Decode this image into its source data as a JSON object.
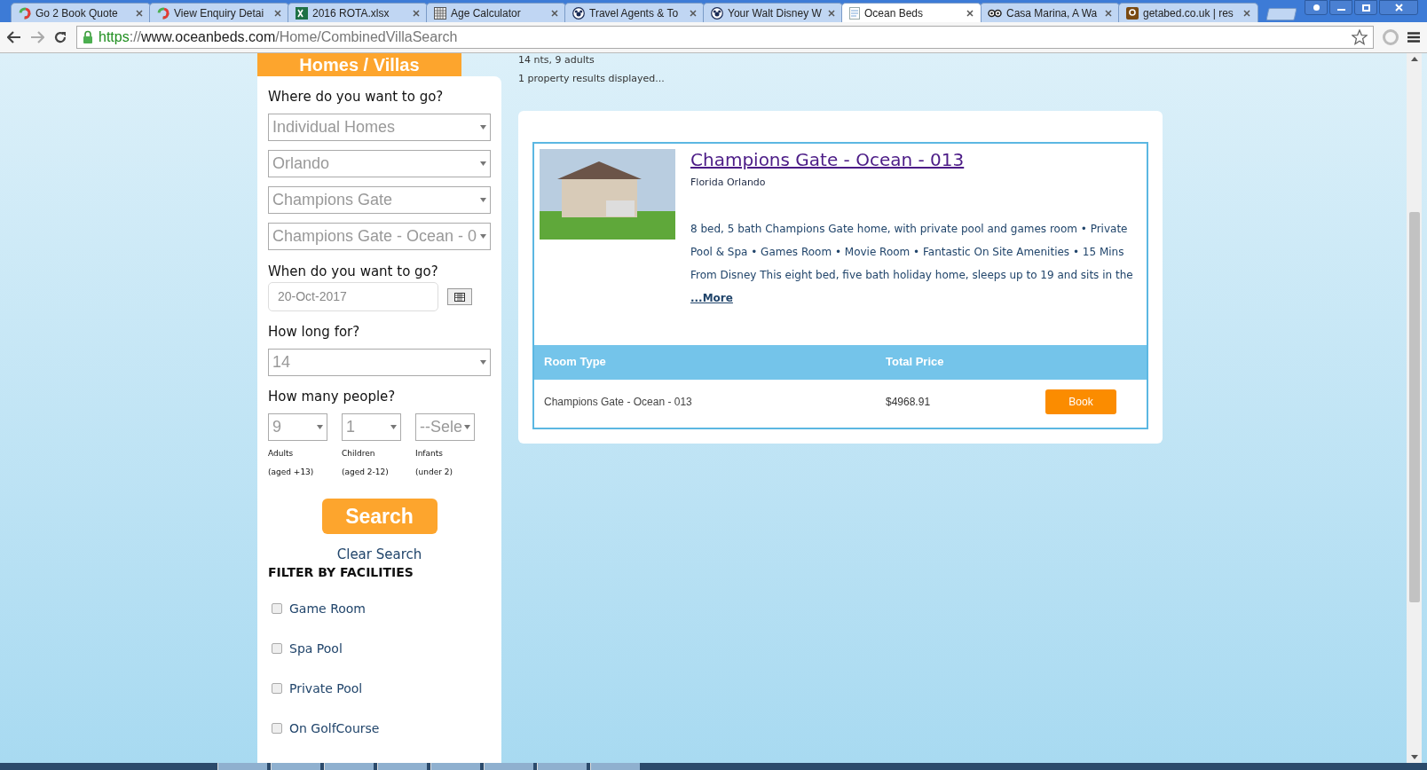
{
  "browser": {
    "tabs": [
      {
        "title": "Go 2 Book Quote",
        "kind": "ring",
        "selected": false
      },
      {
        "title": "View Enquiry Detai",
        "kind": "ring",
        "selected": false
      },
      {
        "title": "2016 ROTA.xlsx",
        "kind": "sheet",
        "selected": false
      },
      {
        "title": "Age Calculator",
        "kind": "grid",
        "selected": false
      },
      {
        "title": "Travel Agents & To",
        "kind": "mouse",
        "selected": false
      },
      {
        "title": "Your Walt Disney W",
        "kind": "mouse",
        "selected": false
      },
      {
        "title": "Ocean Beds",
        "kind": "page",
        "selected": true
      },
      {
        "title": "Casa Marina, A Wa",
        "kind": "owl",
        "selected": false
      },
      {
        "title": "getabed.co.uk | res",
        "kind": "square",
        "selected": false
      }
    ],
    "url": {
      "scheme": "https",
      "separator": "://",
      "host": "www.oceanbeds.com",
      "path": "/Home/CombinedVillaSearch"
    }
  },
  "search": {
    "header": "Homes / Villas",
    "destination_label": "Where do you want to go?",
    "destination_selects": [
      "Individual Homes",
      "Orlando",
      "Champions Gate",
      "Champions Gate - Ocean - 0"
    ],
    "date_label": "When do you want to go?",
    "date_value": "20-Oct-2017",
    "duration_label": "How long for?",
    "duration_value": "14",
    "people_label": "How many people?",
    "people": [
      {
        "value": "9",
        "label": "Adults",
        "sublabel": "(aged +13)"
      },
      {
        "value": "1",
        "label": "Children",
        "sublabel": "(aged 2-12)"
      },
      {
        "value": "--Sele",
        "label": "Infants",
        "sublabel": "(under 2)"
      }
    ],
    "search_button": "Search",
    "clear_link": "Clear Search",
    "filter_title": "FILTER BY FACILITIES",
    "filters": [
      {
        "label": "Game Room",
        "checked": false
      },
      {
        "label": "Spa Pool",
        "checked": false
      },
      {
        "label": "Private Pool",
        "checked": false
      },
      {
        "label": "On GolfCourse",
        "checked": false
      }
    ]
  },
  "results": {
    "summary": "14 nts, 9 adults",
    "count": "1 property results displayed...",
    "property": {
      "title": "Champions Gate - Ocean - 013",
      "location": "Florida Orlando",
      "description": "8 bed, 5 bath Champions Gate home, with private pool and games room • Private Pool & Spa • Games Room • Movie Room • Fantastic On Site Amenities • 15 Mins From Disney This eight bed, five bath holiday home, sleeps up to 19 and sits in the",
      "more_link": "...More",
      "columns": [
        "Room Type",
        "Total Price"
      ],
      "rows": [
        {
          "room_type": "Champions Gate - Ocean - 013",
          "price": "$4968.91",
          "action": "Book"
        }
      ]
    }
  }
}
